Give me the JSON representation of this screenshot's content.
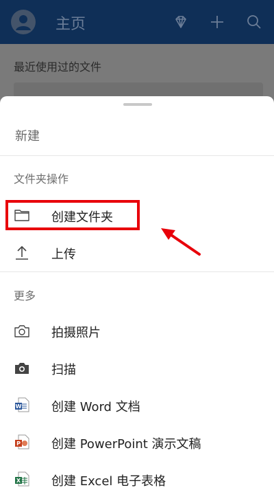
{
  "header": {
    "title": "主页",
    "icons": [
      "avatar-icon",
      "diamond-icon",
      "plus-icon",
      "search-icon"
    ]
  },
  "recent": {
    "title": "最近使用过的文件"
  },
  "sheet": {
    "new_label": "新建",
    "folder_section": "文件夹操作",
    "create_folder": "创建文件夹",
    "upload": "上传",
    "more_section": "更多",
    "take_photo": "拍摄照片",
    "scan": "扫描",
    "create_word": "创建 Word 文档",
    "create_ppt": "创建 PowerPoint 演示文稿",
    "create_excel": "创建 Excel 电子表格"
  },
  "colors": {
    "header_bg": "#0f2f57",
    "highlight": "#e8000a",
    "word": "#2b579a",
    "ppt": "#c43e1c",
    "excel": "#217346"
  }
}
